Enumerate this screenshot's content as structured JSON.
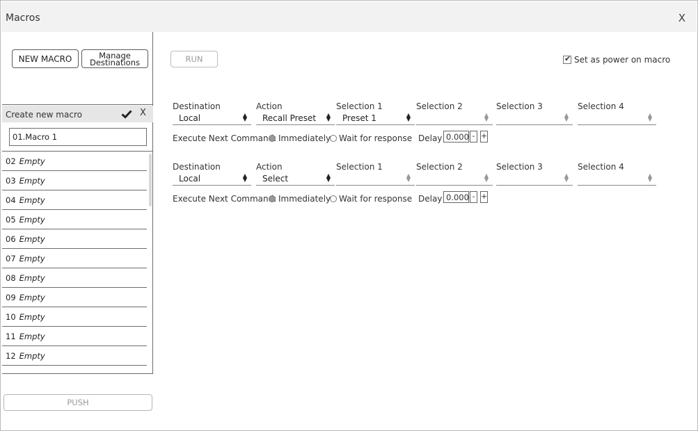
{
  "window": {
    "title": "Macros",
    "close_label": "X"
  },
  "sidebar": {
    "new_macro_label": "NEW MACRO",
    "manage_destinations_label": "Manage Destinations",
    "create_label": "Create new macro",
    "create_close_label": "X",
    "name_value": "01.Macro 1",
    "items": [
      {
        "num": "02",
        "label": "Empty"
      },
      {
        "num": "03",
        "label": "Empty"
      },
      {
        "num": "04",
        "label": "Empty"
      },
      {
        "num": "05",
        "label": "Empty"
      },
      {
        "num": "06",
        "label": "Empty"
      },
      {
        "num": "07",
        "label": "Empty"
      },
      {
        "num": "08",
        "label": "Empty"
      },
      {
        "num": "09",
        "label": "Empty"
      },
      {
        "num": "10",
        "label": "Empty"
      },
      {
        "num": "11",
        "label": "Empty"
      },
      {
        "num": "12",
        "label": "Empty"
      }
    ],
    "push_label": "PUSH"
  },
  "main": {
    "run_label": "RUN",
    "power_on_label": "Set as power on macro",
    "power_on_checked": true,
    "columns": [
      "Destination",
      "Action",
      "Selection 1",
      "Selection 2",
      "Selection 3",
      "Selection 4"
    ],
    "commands": [
      {
        "values": [
          "Local",
          "Recall Preset",
          "Preset 1",
          "",
          "",
          ""
        ],
        "execute_label": "Execute Next Command:",
        "immediately_label": "Immediately",
        "wait_label": "Wait for response",
        "delay_label": "Delay",
        "delay_value": "0.000",
        "minus_label": "-",
        "plus_label": "+"
      },
      {
        "values": [
          "Local",
          "Select",
          "",
          "",
          "",
          ""
        ],
        "execute_label": "Execute Next Command:",
        "immediately_label": "Immediately",
        "wait_label": "Wait for response",
        "delay_label": "Delay",
        "delay_value": "0.000",
        "minus_label": "-",
        "plus_label": "+"
      }
    ]
  }
}
